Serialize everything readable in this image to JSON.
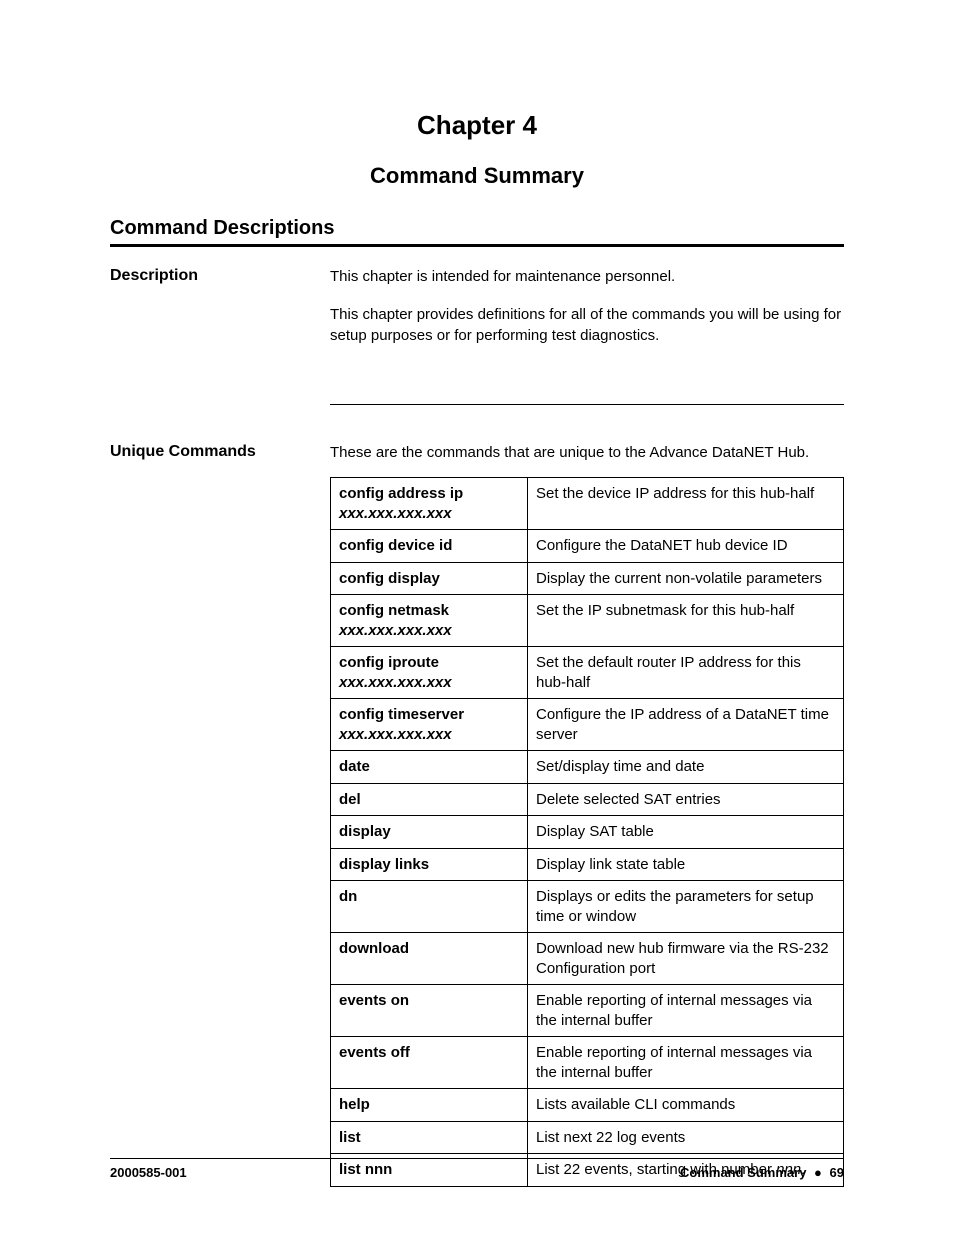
{
  "chapter_number": "Chapter 4",
  "chapter_title": "Command Summary",
  "section_heading": "Command Descriptions",
  "description": {
    "label": "Description",
    "p1": "This chapter is intended for maintenance personnel.",
    "p2": "This chapter provides definitions for all of the commands you will be using for setup purposes or for performing test diagnostics."
  },
  "unique": {
    "label": "Unique Commands",
    "intro": "These are the commands that are unique to the Advance DataNET Hub.",
    "rows": [
      {
        "cmd": "config address ip",
        "param": "xxx.xxx.xxx.xxx",
        "desc": "Set the device IP address for this hub-half"
      },
      {
        "cmd": "config device id",
        "param": "",
        "desc": "Configure the DataNET hub device ID"
      },
      {
        "cmd": "config display",
        "param": "",
        "desc": "Display the current non-volatile parameters"
      },
      {
        "cmd": "config netmask",
        "param": "xxx.xxx.xxx.xxx",
        "desc": "Set the IP subnetmask for this hub-half"
      },
      {
        "cmd": "config iproute",
        "param": "xxx.xxx.xxx.xxx",
        "desc": "Set the default router IP address for this hub-half"
      },
      {
        "cmd": "config timeserver",
        "param": "xxx.xxx.xxx.xxx",
        "desc": "Configure the IP address of a DataNET time server"
      },
      {
        "cmd": "date",
        "param": "",
        "desc": "Set/display time and date"
      },
      {
        "cmd": "del",
        "param": "",
        "desc": "Delete selected SAT entries"
      },
      {
        "cmd": "display",
        "param": "",
        "desc": "Display SAT table"
      },
      {
        "cmd": "display links",
        "param": "",
        "desc": "Display link state table"
      },
      {
        "cmd": "dn",
        "param": "",
        "desc": "Displays or edits the parameters for setup time or window"
      },
      {
        "cmd": "download",
        "param": "",
        "desc": "Download new hub firmware via the RS-232 Configuration port"
      },
      {
        "cmd": "events on",
        "param": "",
        "desc": "Enable reporting of internal messages via the internal buffer"
      },
      {
        "cmd": "events off",
        "param": "",
        "desc": "Enable reporting of internal messages via the internal buffer"
      },
      {
        "cmd": "help",
        "param": "",
        "desc": "Lists available CLI commands"
      },
      {
        "cmd": "list",
        "param": "",
        "desc": "List next 22 log events"
      },
      {
        "cmd": "list nnn",
        "param": "",
        "desc": "List 22 events, starting with number ",
        "desc_italic": "nnn",
        "desc_after": "."
      }
    ]
  },
  "footer": {
    "doc_number": "2000585-001",
    "section": "Command Summary",
    "bullet": "●",
    "page": "69"
  }
}
